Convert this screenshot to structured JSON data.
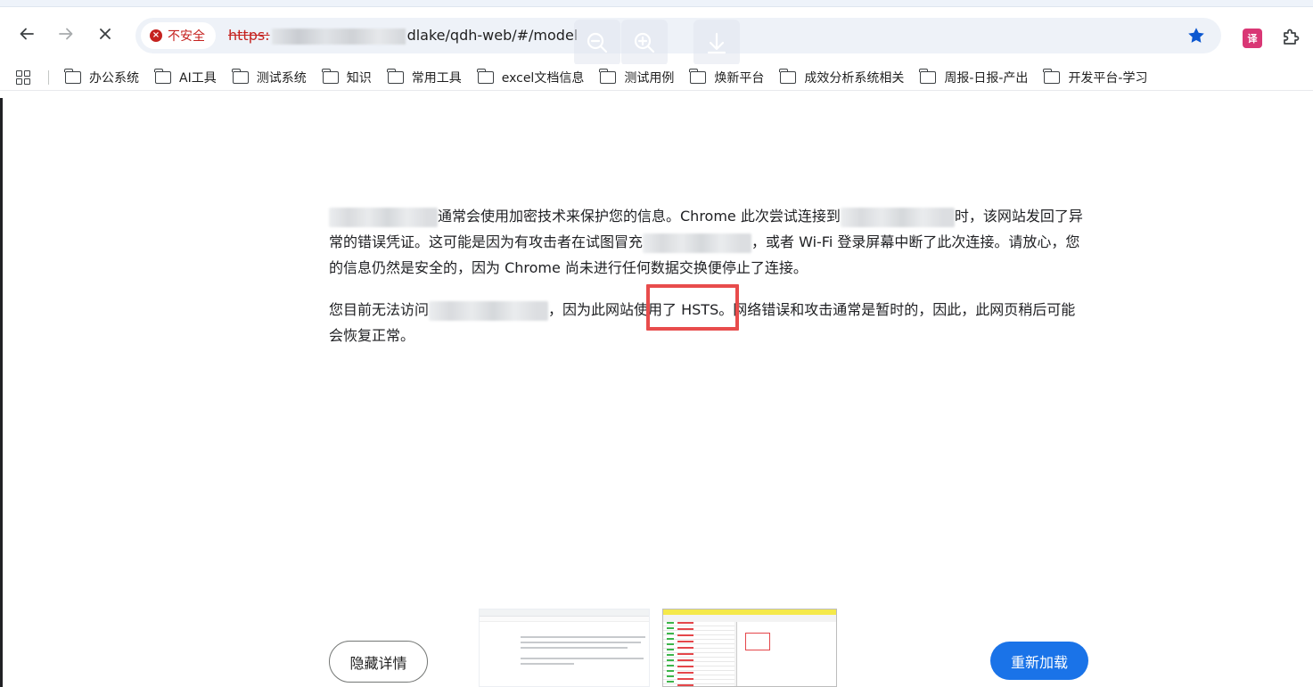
{
  "browser": {
    "security_label": "不安全",
    "url_scheme": "https:",
    "url_rest": "dlake/qdh-web/#/model",
    "icons": [
      "back-arrow-icon",
      "forward-arrow-icon",
      "stop-icon",
      "zoom-out-icon",
      "zoom-in-icon",
      "download-icon",
      "star-icon",
      "translate-icon",
      "extensions-icon"
    ]
  },
  "bookmarks": [
    {
      "label": "办公系统"
    },
    {
      "label": "AI工具"
    },
    {
      "label": "测试系统"
    },
    {
      "label": "知识"
    },
    {
      "label": "常用工具"
    },
    {
      "label": "excel文档信息"
    },
    {
      "label": "测试用例"
    },
    {
      "label": "焕新平台"
    },
    {
      "label": "成效分析系统相关"
    },
    {
      "label": "周报-日报-产出"
    },
    {
      "label": "开发平台-学习"
    }
  ],
  "error": {
    "p1_a": "通常会使用加密技术来保护您的信息。Chrome 此次尝试连接到",
    "p1_b": "时，该网站发回了异常的错误凭证。这可能是因为有攻击者在试图冒充",
    "p1_c": "，或者 Wi-Fi 登录屏幕中断了此次连接。请放心，您的信息仍然是安全的，因为 Chrome 尚未进行任何数据交换便停止了连接。",
    "p2_a": "您目前无法访问",
    "p2_b": "，因为此网站使用了 HSTS。网络错误和攻击通常是暂时的，因此，此网页稍后可能会恢复正常。",
    "hide_details": "隐藏详情",
    "reload": "重新加载"
  },
  "colors": {
    "accent": "#1a73e8",
    "insecure": "#c5221f",
    "annotation_box": "#e84c4c"
  }
}
